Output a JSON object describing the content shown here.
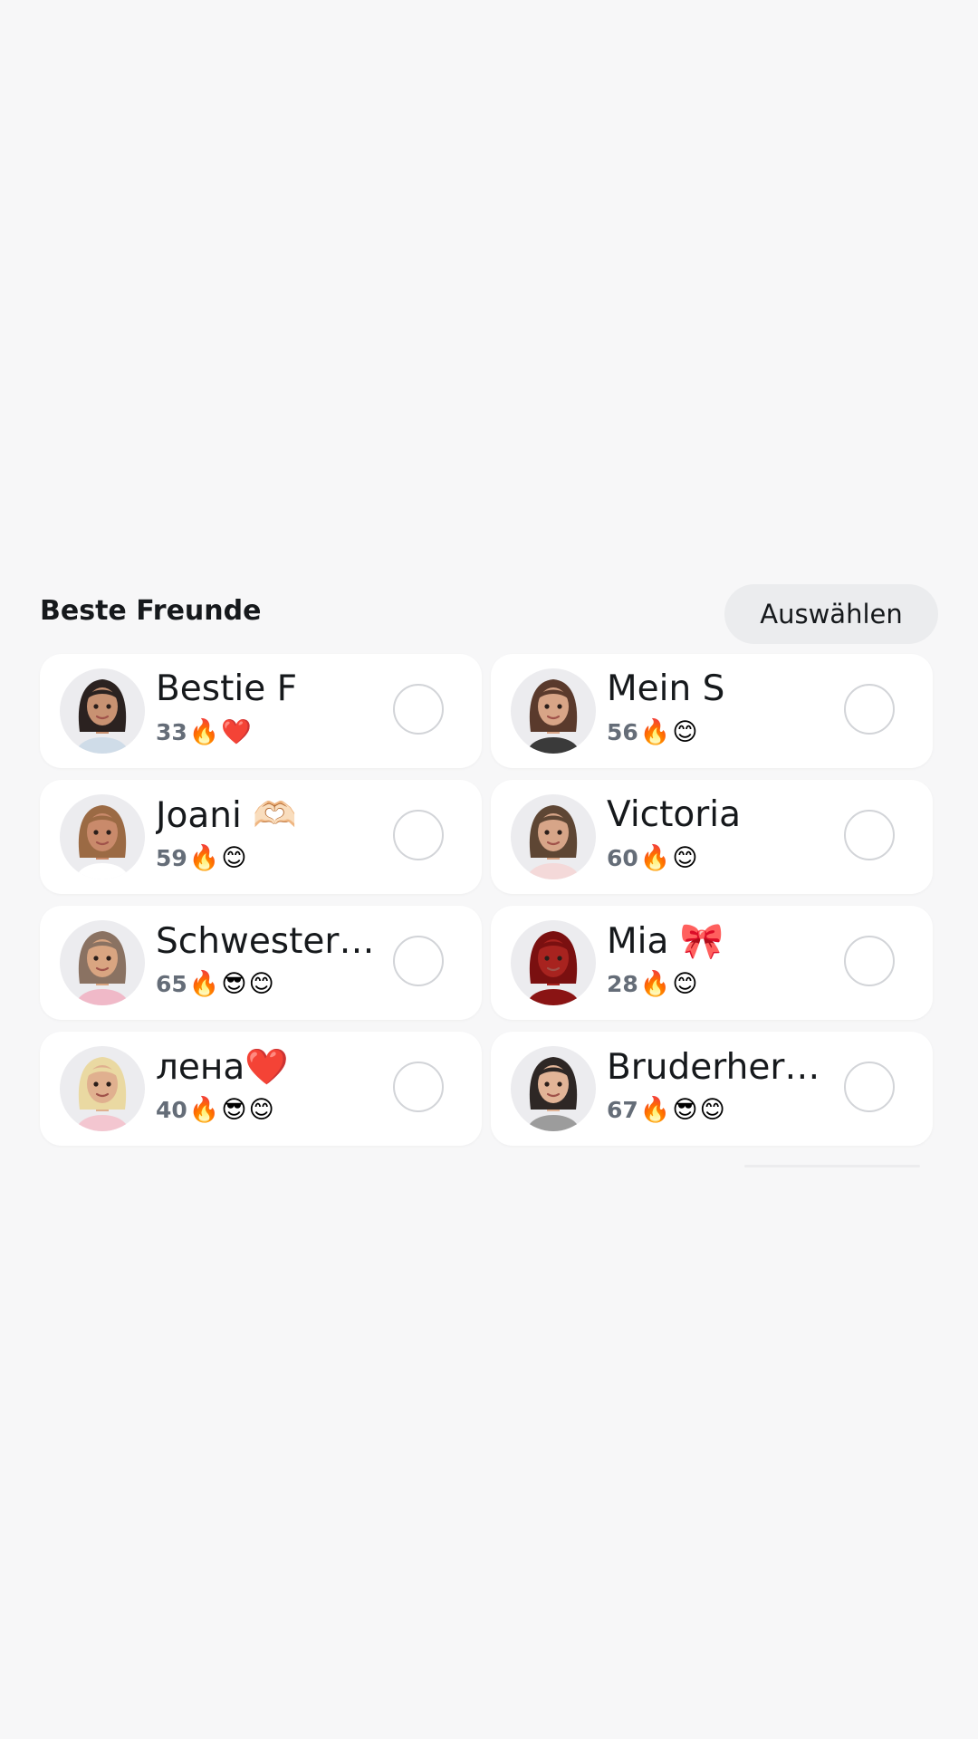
{
  "section": {
    "title": "Beste Freunde",
    "select_label": "Auswählen"
  },
  "friends": [
    {
      "name": "Bestie F",
      "streak": "33",
      "emojis": [
        "🔥",
        "❤️"
      ],
      "hair": "#2b2220",
      "skin": "#c89272",
      "shirt": "#cfdce8"
    },
    {
      "name": "Mein S",
      "streak": "56",
      "emojis": [
        "🔥",
        "😊"
      ],
      "hair": "#5a3a2c",
      "skin": "#d8a587",
      "shirt": "#3a3a3a"
    },
    {
      "name": "Joani 🫶🏻",
      "streak": "59",
      "emojis": [
        "🔥",
        "😊"
      ],
      "hair": "#9b6a44",
      "skin": "#c98a6b",
      "shirt": "#ffffff"
    },
    {
      "name": "Victoria",
      "streak": "60",
      "emojis": [
        "🔥",
        "😊"
      ],
      "hair": "#5e4634",
      "skin": "#d7a588",
      "shirt": "#f4d9d9"
    },
    {
      "name": "Schwester 🌸",
      "streak": "65",
      "emojis": [
        "🔥",
        "😎",
        "😊"
      ],
      "hair": "#8a7262",
      "skin": "#d9a581",
      "shirt": "#f0b9c8"
    },
    {
      "name": "Mia 🎀",
      "streak": "28",
      "emojis": [
        "🔥",
        "😊"
      ],
      "hair": "#7a1010",
      "skin": "#a8231f",
      "shirt": "#8a1414"
    },
    {
      "name": "лена❤️",
      "streak": "40",
      "emojis": [
        "🔥",
        "😎",
        "😊"
      ],
      "hair": "#ead9a2",
      "skin": "#e0b08f",
      "shirt": "#f3c6d0"
    },
    {
      "name": "Bruderherz 💙",
      "streak": "67",
      "emojis": [
        "🔥",
        "😎",
        "😊"
      ],
      "hair": "#2e2725",
      "skin": "#e2b497",
      "shirt": "#9c9c9c"
    }
  ]
}
